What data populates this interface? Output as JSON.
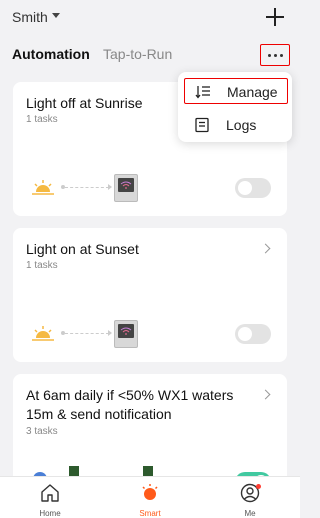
{
  "header": {
    "home_name": "Smith",
    "add_icon": "plus-icon"
  },
  "tabs": [
    {
      "label": "Automation",
      "active": true
    },
    {
      "label": "Tap-to-Run",
      "active": false
    }
  ],
  "more_icon": "more-dots-icon",
  "menu": {
    "items": [
      {
        "label": "Manage",
        "icon": "sort-list-icon"
      },
      {
        "label": "Logs",
        "icon": "document-icon"
      }
    ]
  },
  "cards": [
    {
      "title": "Light off at Sunrise",
      "subtitle": "1 tasks",
      "enabled": false
    },
    {
      "title": "Light on at Sunset",
      "subtitle": "1 tasks",
      "enabled": false
    },
    {
      "title_line1": "At 6am daily if <50% WX1 waters",
      "title_line2": "15m & send notification",
      "subtitle": "3 tasks",
      "enabled": true
    }
  ],
  "nav": {
    "items": [
      {
        "label": "Home",
        "icon": "home-icon",
        "active": false
      },
      {
        "label": "Smart",
        "icon": "smart-sun-icon",
        "active": true
      },
      {
        "label": "Me",
        "icon": "user-icon",
        "active": false
      }
    ]
  },
  "colors": {
    "accent": "#ff5a1a",
    "toggle_on": "#41c9a0",
    "highlight": "#e00000"
  }
}
